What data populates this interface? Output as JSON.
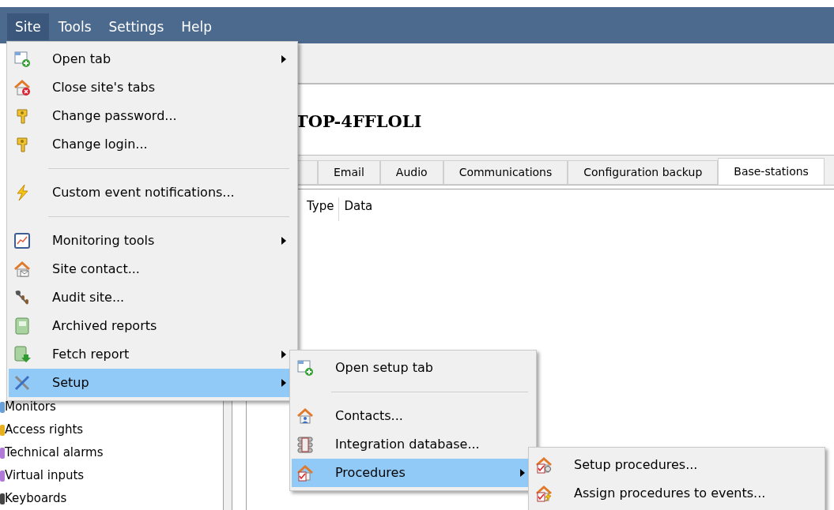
{
  "menubar": [
    {
      "label": "Site",
      "selected": true
    },
    {
      "label": "Tools",
      "selected": false
    },
    {
      "label": "Settings",
      "selected": false
    },
    {
      "label": "Help",
      "selected": false
    }
  ],
  "site_menu": [
    {
      "kind": "item",
      "label": "Open tab",
      "submenu": true,
      "selected": false
    },
    {
      "kind": "item",
      "label": "Close site's tabs",
      "submenu": false,
      "selected": false
    },
    {
      "kind": "item",
      "label": "Change password...",
      "submenu": false,
      "selected": false
    },
    {
      "kind": "item",
      "label": "Change login...",
      "submenu": false,
      "selected": false
    },
    {
      "kind": "separator"
    },
    {
      "kind": "item",
      "label": "Custom event notifications...",
      "submenu": false,
      "selected": false
    },
    {
      "kind": "separator"
    },
    {
      "kind": "item",
      "label": "Monitoring tools",
      "submenu": true,
      "selected": false
    },
    {
      "kind": "item",
      "label": "Site contact...",
      "submenu": false,
      "selected": false
    },
    {
      "kind": "item",
      "label": "Audit site...",
      "submenu": false,
      "selected": false
    },
    {
      "kind": "item",
      "label": "Archived reports",
      "submenu": false,
      "selected": false
    },
    {
      "kind": "item",
      "label": "Fetch report",
      "submenu": true,
      "selected": false
    },
    {
      "kind": "item",
      "label": "Setup",
      "submenu": true,
      "selected": true
    }
  ],
  "setup_menu": [
    {
      "kind": "item",
      "label": "Open setup tab",
      "submenu": false,
      "selected": false
    },
    {
      "kind": "separator"
    },
    {
      "kind": "item",
      "label": "Contacts...",
      "submenu": false,
      "selected": false
    },
    {
      "kind": "item",
      "label": "Integration database...",
      "submenu": false,
      "selected": false
    },
    {
      "kind": "item",
      "label": "Procedures",
      "submenu": true,
      "selected": true
    }
  ],
  "procedures_menu": [
    {
      "kind": "item",
      "label": "Setup procedures...",
      "submenu": false,
      "selected": false
    },
    {
      "kind": "item",
      "label": "Assign procedures to events...",
      "submenu": false,
      "selected": false
    }
  ],
  "tree": [
    {
      "label": "Monitors"
    },
    {
      "label": "Access rights"
    },
    {
      "label": "Technical alarms"
    },
    {
      "label": "Virtual inputs"
    },
    {
      "label": "Keyboards"
    }
  ],
  "site_title": "TOP-4FFLOLI",
  "tabs": [
    {
      "selected": false
    },
    {
      "label": "Email",
      "selected": false
    },
    {
      "label": "Audio",
      "selected": false
    },
    {
      "label": "Communications",
      "selected": false
    },
    {
      "label": "Configuration backup",
      "selected": false
    },
    {
      "label": "Base-stations",
      "selected": true
    }
  ],
  "table": {
    "columns": [
      "Type",
      "Data"
    ]
  }
}
